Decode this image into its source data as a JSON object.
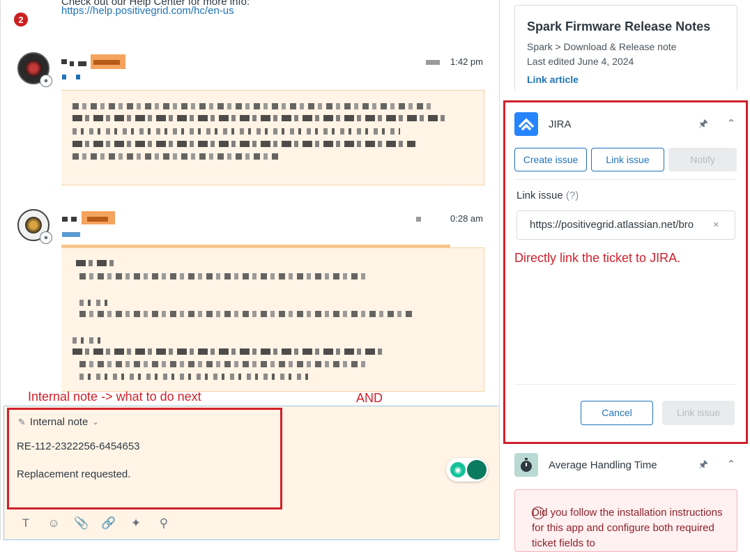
{
  "conversation": {
    "help_text": "Check out our Help Center for more info:",
    "help_link": "https://help.positivegrid.com/hc/en-us",
    "badge_count": "2",
    "messages": [
      {
        "timestamp": "1:42 pm"
      },
      {
        "timestamp": "0:28 am"
      }
    ],
    "annotation_left": "Internal note -> what to do next",
    "annotation_and": "AND"
  },
  "composer": {
    "note_type": "Internal note",
    "lines": [
      "RE-112-2322256-6454653",
      "Replacement requested."
    ],
    "tools": [
      "text-format-icon",
      "emoji-icon",
      "attachment-icon",
      "link-icon",
      "magic-wand-icon",
      "search-icon"
    ]
  },
  "apps": {
    "kb_article": {
      "title": "Spark Firmware Release Notes",
      "breadcrumb": "Spark  >  Download & Release note",
      "edited": "Last edited June 4, 2024",
      "link_label": "Link article"
    },
    "jira": {
      "title": "JIRA",
      "create_label": "Create issue",
      "link_label": "Link issue",
      "notify_label": "Notify",
      "field_label": "Link issue",
      "field_hint": "(?)",
      "field_value": "https://positivegrid.atlassian.net/bro",
      "annotation": "Directly link the ticket to JIRA.",
      "cancel_label": "Cancel",
      "submit_label": "Link issue"
    },
    "aht": {
      "title": "Average Handling Time",
      "warning": "Did you follow the installation instructions for this app and configure both required ticket fields to"
    }
  },
  "colors": {
    "annotation_red": "#d0202a",
    "link_blue": "#1f73b7",
    "note_bg": "#fff4e6"
  }
}
